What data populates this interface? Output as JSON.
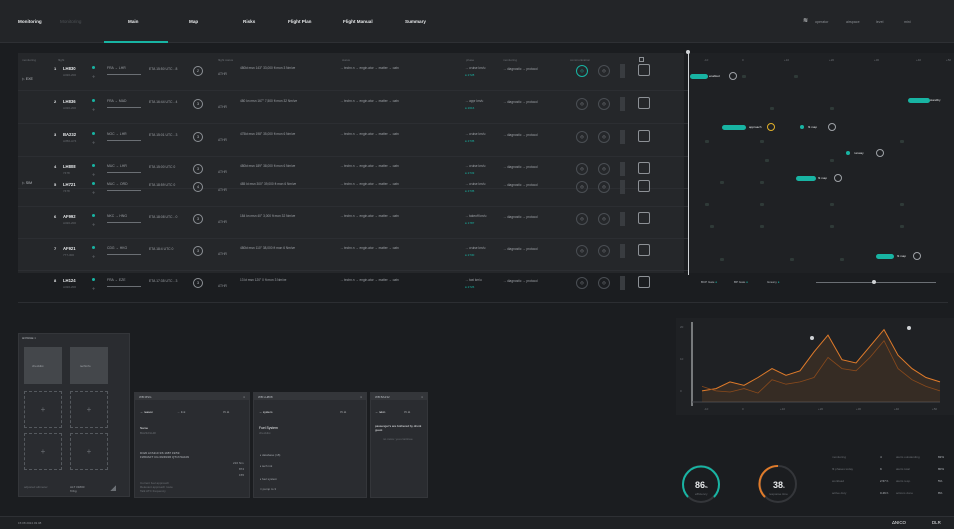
{
  "topbar": {
    "monitoring": "Monitoring",
    "tab_dim": "Monitoring",
    "tabs": [
      "Main",
      "Map",
      "Risks",
      "Flight Plan",
      "Flight Manual",
      "Summary"
    ],
    "right_items": [
      "operator",
      "airspace",
      "level",
      "mini"
    ]
  },
  "table": {
    "headers": [
      "monitoring",
      "flight",
      "flight status",
      "status",
      "phase",
      "monitoring",
      "communication"
    ],
    "groups": [
      "EXE",
      "SIM"
    ],
    "rows": [
      {
        "num": "1",
        "cs": "LH830",
        "sub": "A320-200",
        "route": "FRA → LHR",
        "eta": "ETA 15:50 UTC - 8",
        "ic": "2",
        "stat": "480kt  msn  143°  33,000 ft  mon  3 Nm/ve",
        "sq": "→ techn.n  →  engin.ator  →  matter  →  oatn",
        "sv": "→ cruise  km/u",
        "sv2": "● 2728",
        "mon": "→ diagnostic  → protocol"
      },
      {
        "num": "2",
        "cs": "LH836",
        "sub": "A320-200",
        "route": "FRA → MAD",
        "eta": "ETA 16:44 UTC - 4",
        "ic": "3",
        "stat": "480 kn  msn  167°  7,500 ft  mon  32 Nm/ve",
        "sq": "→ techn.n  →  engin.ator  →  matter  →  oatn",
        "sv": "→ appr  km/u",
        "sv2": "● 2616",
        "mon": "→ diagnostic  → protocol"
      },
      {
        "num": "3",
        "cs": "BA232",
        "sub": "A350-A74",
        "route": "NOC → LHR",
        "eta": "ETA 15:01 UTC - 3",
        "ic": "3",
        "stat": "475kt  msn  198°  35,000 ft  mon  6 Nm/ve",
        "sq": "→ techn.n  →  engin.ator  →  matter  →  oatn",
        "sv": "→ cruise  km/u",
        "sv2": "● 2735",
        "mon": "→ diagnostic  → protocol"
      },
      {
        "num": "4",
        "cs": "LH808",
        "sub": "7478",
        "route": "MUC → LHR",
        "eta": "ETA 15:00 UTC 0",
        "ic": "3",
        "stat": "480kt  msn  189°  38,000 ft  mon  6 Nm/ve",
        "sq": "→ techn.n  →  engin.ator  →  matter  →  oatn",
        "sv": "→ cruise  km/u",
        "sv2": "● 2733",
        "mon": "→ diagnostic  → protocol"
      },
      {
        "num": "5",
        "cs": "LH721",
        "sub": "7478",
        "route": "MUC → ORD",
        "eta": "ETA 18:59 UTC 0",
        "ic": "4",
        "stat": "485 kt  msn  300°  39,000 ft  mon  6 Nm/ve",
        "sq": "→ techn.n  →  engin.ator  →  matter  →  oatn",
        "sv": "→ cruise  km/u",
        "sv2": "● 2735",
        "mon": "→ diagnostic  → protocol"
      },
      {
        "num": "6",
        "cs": "AF992",
        "sub": "A320-200",
        "route": "NKC → HNG",
        "eta": "ETA 18:08 UTC - 0",
        "ic": "3",
        "stat": "184 kn  msn  40°  3,000 ft  mon  32 Nm/ve",
        "sq": "→ techn.n  →  engin.ator  →  matter  →  oatn",
        "sv": "→ takeoff  km/u",
        "sv2": "● 1787",
        "mon": "→ diagnostic  → protocol"
      },
      {
        "num": "7",
        "cs": "AF921",
        "sub": "777-300",
        "route": "CDG → HKG",
        "eta": "ETA 18:4 UTC 0",
        "ic": "3",
        "stat": "480kt  msn  110°  38,000 ft  mon  6 Nm/ve",
        "sq": "→ techn.n  →  engin.ator  →  matter  →  oatn",
        "sv": "→ cruise  km/u",
        "sv2": "● 2730",
        "mon": "→ diagnostic  → protocol"
      },
      {
        "num": "8",
        "cs": "LH124",
        "sub": "A320-200",
        "route": "FRA → EZE",
        "eta": "ETA 17:35 UTC - 3",
        "ic": "3",
        "stat": "13 kt  msn  120°  0 ft  mon  3 Nm/ve",
        "sq": "→ techn.n  →  engin.ator  →  matter  →  oatn",
        "sv": "→ taxi  km/u",
        "sv2": "● 2726",
        "mon": "→ diagnostic  → protocol"
      }
    ],
    "atr": "ATHR"
  },
  "timeline": {
    "ticks": [
      "-10",
      "0",
      "+10",
      "+20",
      "+30",
      "+40",
      "+50"
    ],
    "labels": {
      "enabled": "enabled",
      "standby": "standby",
      "approach": "approach",
      "fit_map": "fit map",
      "runway": "runway",
      "fit_map2": "fit map",
      "fit_map3": "fit map"
    },
    "legend": [
      "BCP Gate",
      "BP Gate",
      "Grauny"
    ]
  },
  "left_panel": {
    "title": "PAGE",
    "tile1": "checklist",
    "tile2": "techinfo",
    "footer_left": "adjusted altimeter",
    "footer_mid": "ALT 31800\nfl tbg"
  },
  "cards": [
    {
      "title": "WB  MSG",
      "tag": "→ reason",
      "sub": "→ link",
      "name": "Name",
      "note": "BA232/LHR",
      "block": "D320 A7A310 3/6 1987 19/59\nFWD/AFT CG 09/49/36 QT17/3A109",
      "vals": [
        "216 Nm",
        "874",
        "155"
      ],
      "foot": "Current fuel approach\nRelevant approach route\nTalk ATC frequency"
    },
    {
      "title": "WB  LH808",
      "tag": "→ system",
      "name": "Fuel System",
      "sub": "checklist",
      "items": [
        "database (18)",
        "tech ink",
        "fuel system",
        "pump to 3"
      ]
    },
    {
      "title": "WB  BA232",
      "tag": "→ relvn",
      "text": "passenger's are bothered by drunk guest",
      "sub2": "no more: you continue"
    }
  ],
  "chart_data": {
    "type": "area",
    "series": [
      {
        "values": [
          10,
          12,
          18,
          15,
          22,
          30,
          24,
          28,
          45,
          60,
          38,
          35,
          50,
          65,
          42,
          30,
          22,
          18
        ]
      },
      {
        "values": [
          14,
          10,
          9,
          12,
          8,
          20,
          16,
          18,
          22,
          40,
          30,
          28,
          40,
          55,
          30,
          20,
          14,
          10
        ]
      }
    ],
    "yticks": [
      "20",
      "10",
      "0"
    ],
    "xticks": [
      "-10",
      "0",
      "+10",
      "+20",
      "+30",
      "+40",
      "+50"
    ]
  },
  "gauges": [
    {
      "value": "86",
      "unit": "%",
      "label": "efficiency"
    },
    {
      "value": "38",
      "unit": "s",
      "label": "response time"
    }
  ],
  "stats": [
    [
      "monitoring",
      "4",
      "alerts outstanding",
      "82%"
    ],
    [
      "flt phases today",
      "9",
      "alerts total",
      "80%"
    ],
    [
      "workload",
      "2.57 h",
      "alerts resp.",
      "5%"
    ],
    [
      "active duty",
      "0.46 h",
      "actions done",
      "8%"
    ]
  ],
  "bottombar": {
    "left": "15:08  2024.03.08",
    "brand": "ΔNICO",
    "brand2": "DLR"
  },
  "colors": {
    "accent": "#18b4a3",
    "orange": "#e07b2a",
    "bg": "#1b1d20"
  }
}
